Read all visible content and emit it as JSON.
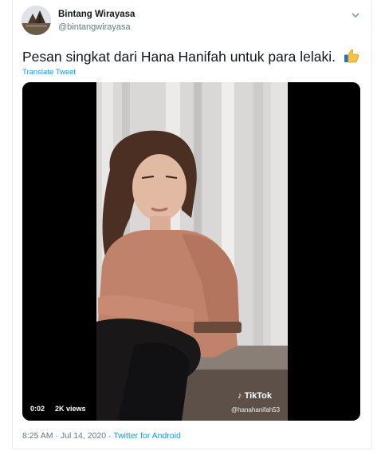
{
  "author": {
    "name": "Bintang Wirayasa",
    "handle": "@bintangwirayasa"
  },
  "tweet": {
    "text": "Pesan singkat dari Hana Hanifah untuk para lelaki.",
    "translate_label": "Translate Tweet"
  },
  "video": {
    "duration": "0:02",
    "views": "2K views",
    "watermark_brand": "TikTok",
    "watermark_handle": "@hanahanifah53"
  },
  "meta": {
    "time": "8:25 AM",
    "separator": " · ",
    "date": "Jul 14, 2020",
    "client": "Twitter for Android"
  },
  "colors": {
    "link": "#1b95e0",
    "muted": "#657786",
    "text": "#14171a"
  },
  "icons": {
    "more": "chevron-down-icon",
    "emoji": "thumbs-up-icon",
    "brand": "tiktok-logo-icon"
  }
}
